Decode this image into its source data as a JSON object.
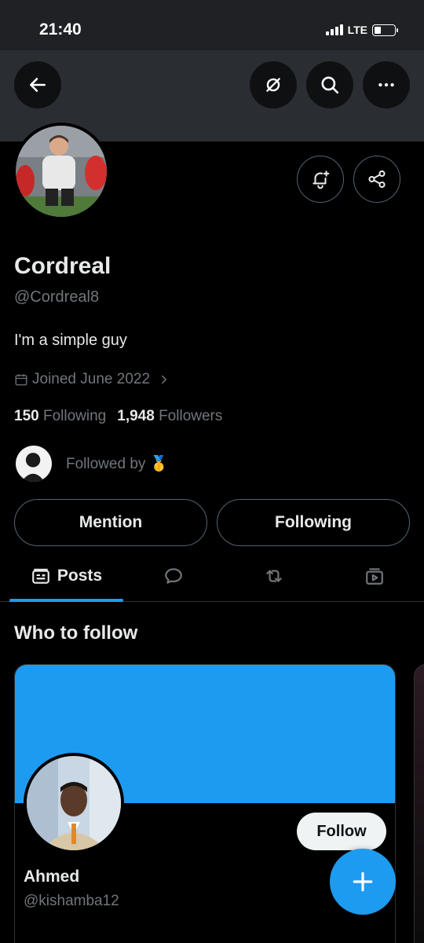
{
  "status_bar": {
    "time": "21:40",
    "network": "LTE",
    "battery_level": 0.25
  },
  "header": {
    "back_icon": "back-arrow-icon",
    "grok_icon": "grok-icon",
    "search_icon": "search-icon",
    "more_icon": "more-icon"
  },
  "profile": {
    "name": "Cordreal",
    "handle": "@Cordreal8",
    "bio": "I'm a simple guy",
    "joined": "Joined June 2022",
    "following_count": "150",
    "following_label": "Following",
    "followers_count": "1,948",
    "followers_label": "Followers",
    "followed_by": "Followed by 🥇"
  },
  "actions": {
    "mention": "Mention",
    "following": "Following"
  },
  "tabs": [
    {
      "label": "Posts",
      "icon": "posts-icon"
    },
    {
      "label": "",
      "icon": "replies-icon"
    },
    {
      "label": "",
      "icon": "repost-icon"
    },
    {
      "label": "",
      "icon": "media-icon"
    }
  ],
  "who_to_follow": {
    "title": "Who to follow",
    "cards": [
      {
        "name": "Ahmed",
        "handle": "@kishamba12",
        "follow_label": "Follow",
        "banner_color": "#1d9bf0"
      }
    ]
  },
  "colors": {
    "accent": "#1d9bf0",
    "muted": "#71767b",
    "text": "#e7e9ea"
  }
}
